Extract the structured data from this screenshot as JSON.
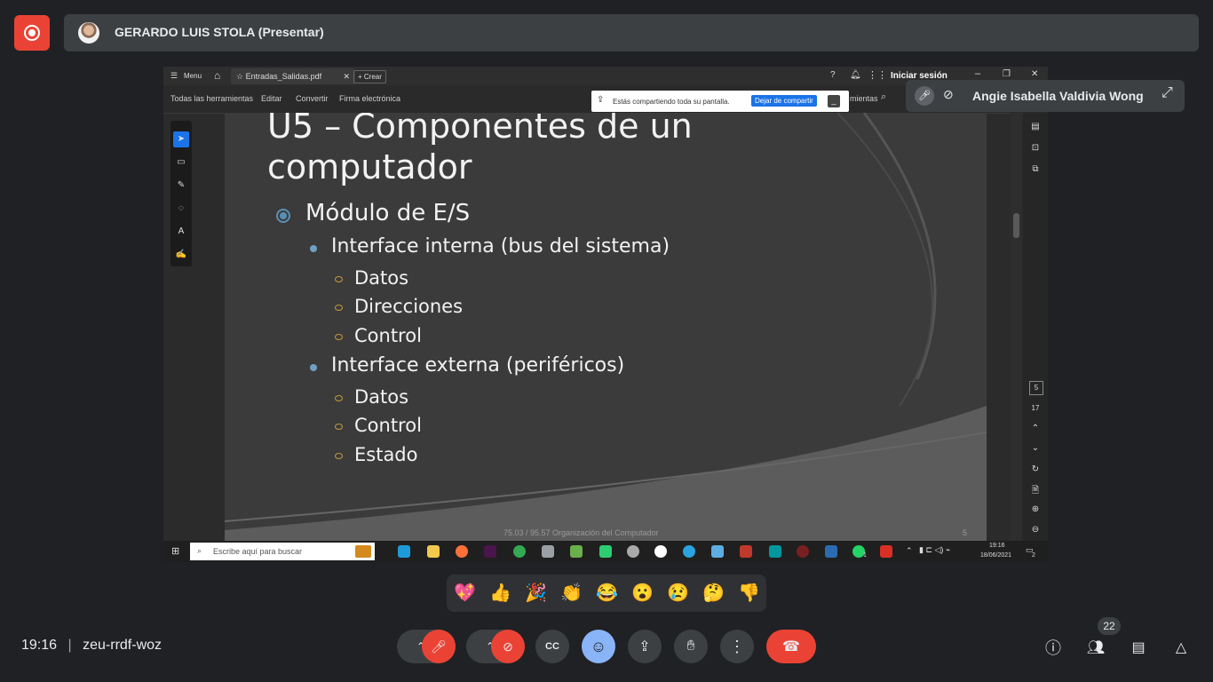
{
  "recording": {
    "icon": "record-icon"
  },
  "presenter": {
    "name": "GERARDO LUIS STOLA (Presentar)"
  },
  "acrobat": {
    "menu_label": "Menu",
    "tab_label": "Entradas_Salidas.pdf",
    "create_label": "Crear",
    "signin_label": "Iniciar sesión",
    "toolbar": [
      "Todas las herramientas",
      "Editar",
      "Convertir",
      "Firma electrónica"
    ],
    "search_hint": "mientas"
  },
  "share_banner": {
    "text": "Estás compartiendo toda su pantalla.",
    "stop_label": "Dejar de compartir",
    "min_label": "_"
  },
  "slide": {
    "title_line1": "U5 – Componentes de un",
    "title_line2": "computador",
    "level0": "Módulo de E/S",
    "group1": {
      "heading": "Interface interna (bus del sistema)",
      "items": [
        "Datos",
        "Direcciones",
        "Control"
      ]
    },
    "group2": {
      "heading": "Interface externa (periféricos)",
      "items": [
        "Datos",
        "Control",
        "Estado"
      ]
    },
    "footer": "75.03 / 95.57 Organización del Computador",
    "page": "5"
  },
  "pdf_nav": {
    "current_page": "5",
    "total_pages": "17"
  },
  "taskbar": {
    "search_placeholder": "Escribe aquí para buscar",
    "time": "19:16",
    "date": "18/06/2021",
    "notif_count": "2",
    "whatsapp_count": "1"
  },
  "tile": {
    "name": "Angie Isabella Valdivia Wong"
  },
  "reactions": [
    "💖",
    "👍",
    "🎉",
    "👏",
    "😂",
    "😮",
    "😢",
    "🤔",
    "👎"
  ],
  "meeting": {
    "time": "19:16",
    "code": "zeu-rrdf-woz",
    "participants": "22"
  },
  "colors": {
    "background": "#202124",
    "end_call": "#ea4335",
    "mic_off": "#ea4335",
    "reaction_active": "#8ab4f8"
  }
}
